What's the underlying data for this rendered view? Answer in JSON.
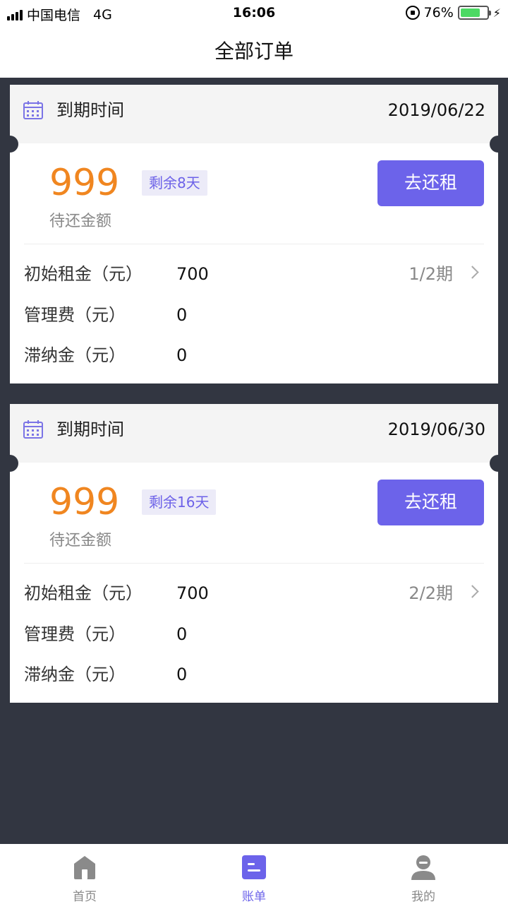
{
  "status_bar": {
    "carrier": "中国电信",
    "network": "4G",
    "time": "16:06",
    "battery": "76%",
    "battery_level": 0.76
  },
  "nav": {
    "title": "全部订单"
  },
  "colors": {
    "accent": "#6c63ea",
    "amount": "#f08620",
    "background": "#323641"
  },
  "orders": [
    {
      "header_label": "到期时间",
      "due_date": "2019/06/22",
      "amount": "999",
      "remaining": "剩余8天",
      "amount_label": "待还金额",
      "pay_button": "去还租",
      "rows": [
        {
          "label": "初始租金（元）",
          "value": "700",
          "period": "1/2期"
        },
        {
          "label": "管理费（元）",
          "value": "0"
        },
        {
          "label": "滞纳金（元）",
          "value": "0"
        }
      ]
    },
    {
      "header_label": "到期时间",
      "due_date": "2019/06/30",
      "amount": "999",
      "remaining": "剩余16天",
      "amount_label": "待还金额",
      "pay_button": "去还租",
      "rows": [
        {
          "label": "初始租金（元）",
          "value": "700",
          "period": "2/2期"
        },
        {
          "label": "管理费（元）",
          "value": "0"
        },
        {
          "label": "滞纳金（元）",
          "value": "0"
        }
      ]
    }
  ],
  "tabs": [
    {
      "label": "首页",
      "icon": "home-icon",
      "active": false
    },
    {
      "label": "账单",
      "icon": "bill-icon",
      "active": true
    },
    {
      "label": "我的",
      "icon": "user-icon",
      "active": false
    }
  ]
}
